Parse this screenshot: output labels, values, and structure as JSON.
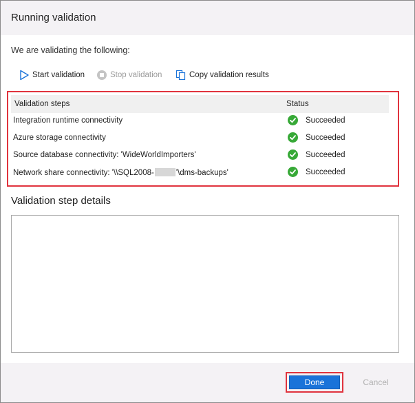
{
  "dialog": {
    "title": "Running validation",
    "intro": "We are validating the following:"
  },
  "toolbar": {
    "start_label": "Start validation",
    "stop_label": "Stop validation",
    "copy_label": "Copy validation results"
  },
  "steps": {
    "headers": {
      "step": "Validation steps",
      "status": "Status"
    },
    "rows": [
      {
        "step": "Integration runtime connectivity",
        "status": "Succeeded"
      },
      {
        "step": "Azure storage connectivity",
        "status": "Succeeded"
      },
      {
        "step": "Source database connectivity: 'WideWorldImporters'",
        "status": "Succeeded"
      },
      {
        "step_prefix": "Network share connectivity: '\\\\SQL2008-",
        "step_suffix": "'\\dms-backups'",
        "status": "Succeeded"
      }
    ]
  },
  "details": {
    "title": "Validation step details"
  },
  "footer": {
    "done_label": "Done",
    "cancel_label": "Cancel"
  },
  "colors": {
    "accent": "#1a73d9",
    "highlight": "#e0333d",
    "success": "#37a937"
  }
}
